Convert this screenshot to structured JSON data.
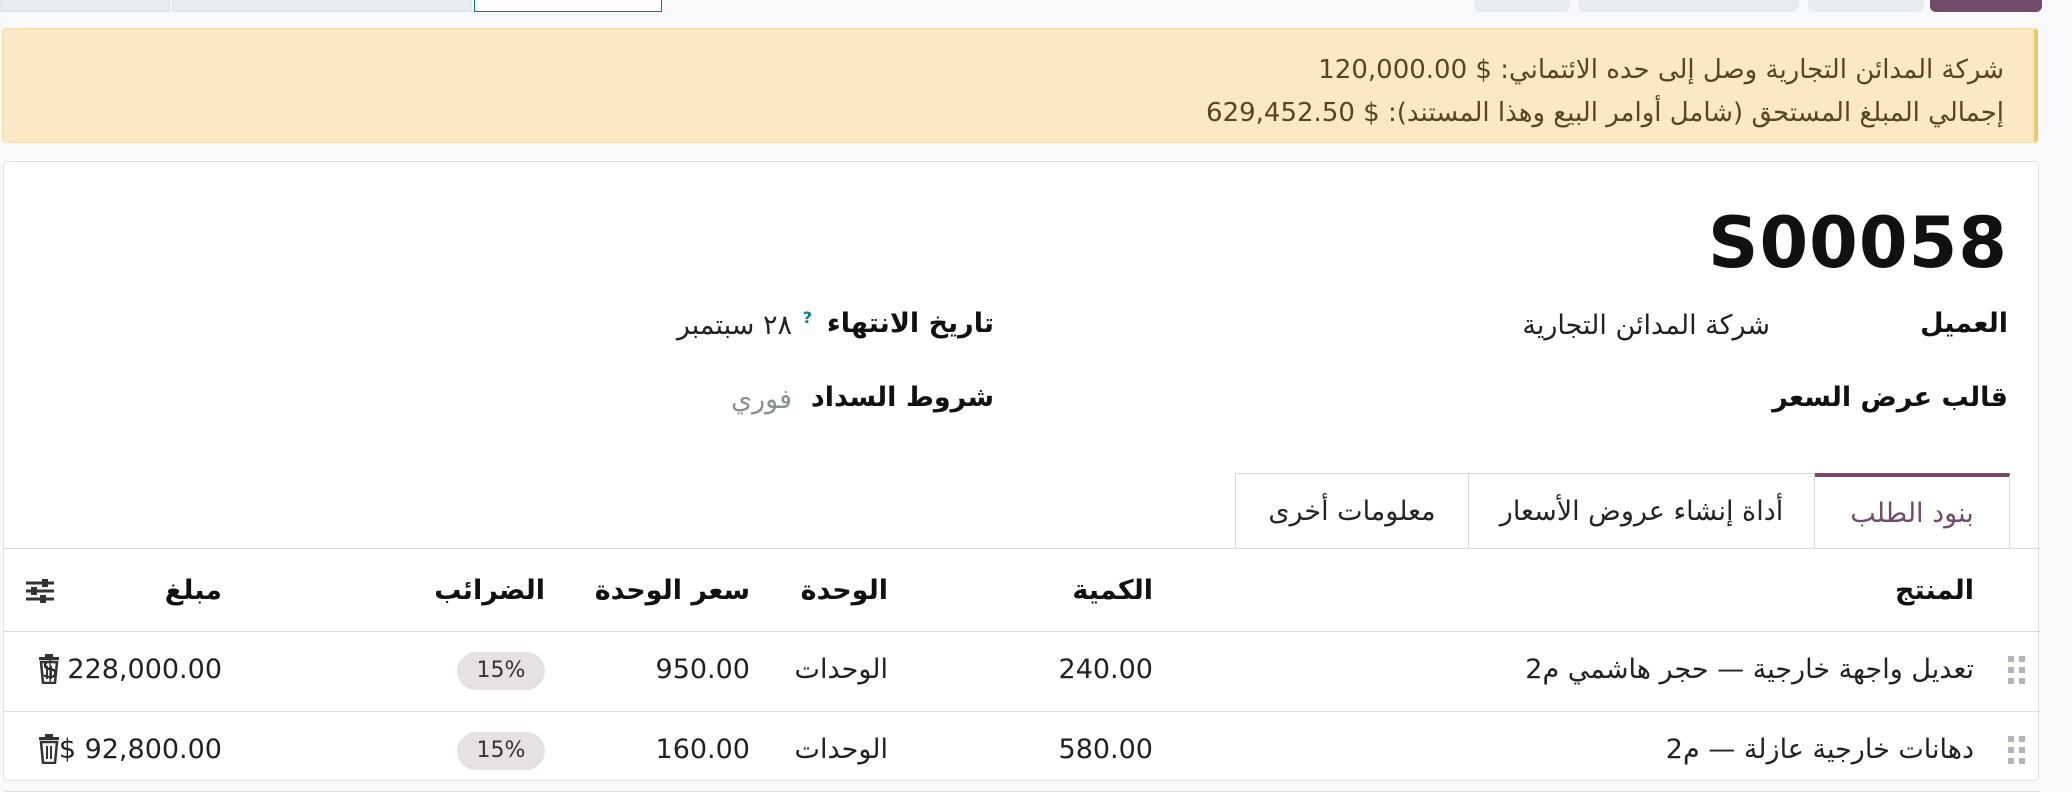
{
  "alert": {
    "line1": "شركة المدائن التجارية وصل إلى حده الائتماني: $ 120,000.00",
    "line2": "إجمالي المبلغ المستحق (شامل أوامر البيع وهذا المستند): $ 629,452.50"
  },
  "order": {
    "name": "S00058",
    "customer_label": "العميل",
    "customer_value": "شركة المدائن التجارية",
    "template_label": "قالب عرض السعر",
    "expiry_label": "تاريخ الانتهاء",
    "expiry_help": "?",
    "expiry_value": "٢٨ سبتمبر",
    "payment_label": "شروط السداد",
    "payment_value": "فوري"
  },
  "tabs": [
    {
      "label": "بنود الطلب"
    },
    {
      "label": "أداة إنشاء عروض الأسعار"
    },
    {
      "label": "معلومات أخرى"
    }
  ],
  "columns": {
    "product": "المنتج",
    "quantity": "الكمية",
    "unit": "الوحدة",
    "unit_price": "سعر الوحدة",
    "taxes": "الضرائب",
    "amount": "مبلغ"
  },
  "rows": [
    {
      "product": "تعديل واجهة خارجية — حجر هاشمي م2",
      "quantity": "240.00",
      "unit": "الوحدات",
      "unit_price": "950.00",
      "tax": "15%",
      "amount": "$ 228,000.00"
    },
    {
      "product": "دهانات خارجية عازلة — م2",
      "quantity": "580.00",
      "unit": "الوحدات",
      "unit_price": "160.00",
      "tax": "15%",
      "amount": "$ 92,800.00"
    }
  ],
  "colors": {
    "accent": "#714b67",
    "warning_bg": "#fbe8c4",
    "tax_badge": "#e8e1e4"
  },
  "icons": [
    "drag-handle-icon",
    "trash-icon",
    "optional-columns-icon",
    "help-icon"
  ]
}
